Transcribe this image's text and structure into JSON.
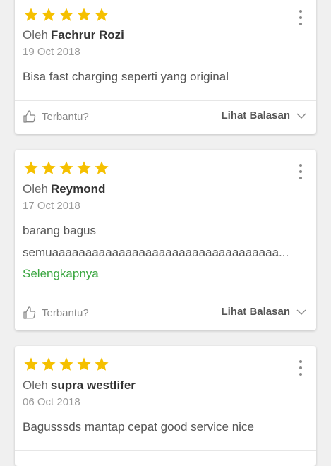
{
  "reviews": [
    {
      "rating": 5,
      "by_label": "Oleh",
      "author": "Fachrur Rozi",
      "date": "19 Oct 2018",
      "lines": [
        "Bisa fast charging seperti yang original"
      ],
      "read_more": "",
      "helpful_label": "Terbantu?",
      "replies_label": "Lihat Balasan"
    },
    {
      "rating": 5,
      "by_label": "Oleh",
      "author": "Reymond",
      "date": "17 Oct 2018",
      "lines": [
        "barang bagus",
        "semuaaaaaaaaaaaaaaaaaaaaaaaaaaaaaaaaaa..."
      ],
      "read_more": "Selengkapnya",
      "helpful_label": "Terbantu?",
      "replies_label": "Lihat Balasan"
    },
    {
      "rating": 5,
      "by_label": "Oleh",
      "author": "supra westlifer",
      "date": "06 Oct 2018",
      "lines": [
        "Bagusssds mantap cepat good service nice"
      ],
      "read_more": "",
      "helpful_label": "",
      "replies_label": ""
    }
  ],
  "colors": {
    "star": "#f5c000",
    "link_green": "#3aa640",
    "background": "#f0f0f0",
    "card": "#ffffff"
  },
  "icons": {
    "star": "star-icon",
    "more": "more-vertical-icon",
    "thumb": "thumbs-up-icon",
    "chevron": "chevron-down-icon"
  }
}
